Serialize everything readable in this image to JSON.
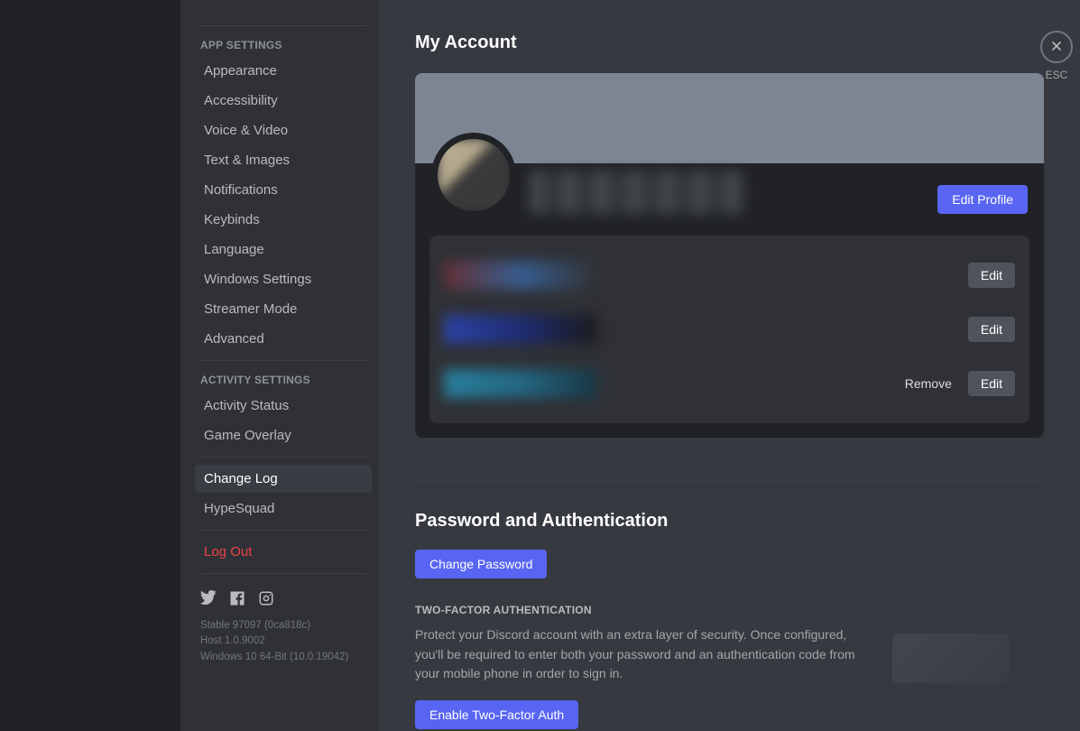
{
  "sidebar": {
    "app_settings_header": "APP SETTINGS",
    "app_settings_items": [
      "Appearance",
      "Accessibility",
      "Voice & Video",
      "Text & Images",
      "Notifications",
      "Keybinds",
      "Language",
      "Windows Settings",
      "Streamer Mode",
      "Advanced"
    ],
    "activity_settings_header": "ACTIVITY SETTINGS",
    "activity_settings_items": [
      "Activity Status",
      "Game Overlay"
    ],
    "misc_items": [
      "Change Log",
      "HypeSquad"
    ],
    "logout_label": "Log Out",
    "build_info": [
      "Stable 97097 (0ca818c)",
      "Host 1.0.9002",
      "Windows 10 64-Bit (10.0.19042)"
    ]
  },
  "close": {
    "esc_label": "ESC"
  },
  "account": {
    "page_title": "My Account",
    "edit_profile_label": "Edit Profile",
    "edit_label": "Edit",
    "remove_label": "Remove"
  },
  "auth": {
    "section_title": "Password and Authentication",
    "change_password_label": "Change Password",
    "tfa_header": "TWO-FACTOR AUTHENTICATION",
    "tfa_body": "Protect your Discord account with an extra layer of security. Once configured, you'll be required to enter both your password and an authentication code from your mobile phone in order to sign in.",
    "enable_tfa_label": "Enable Two-Factor Auth"
  }
}
